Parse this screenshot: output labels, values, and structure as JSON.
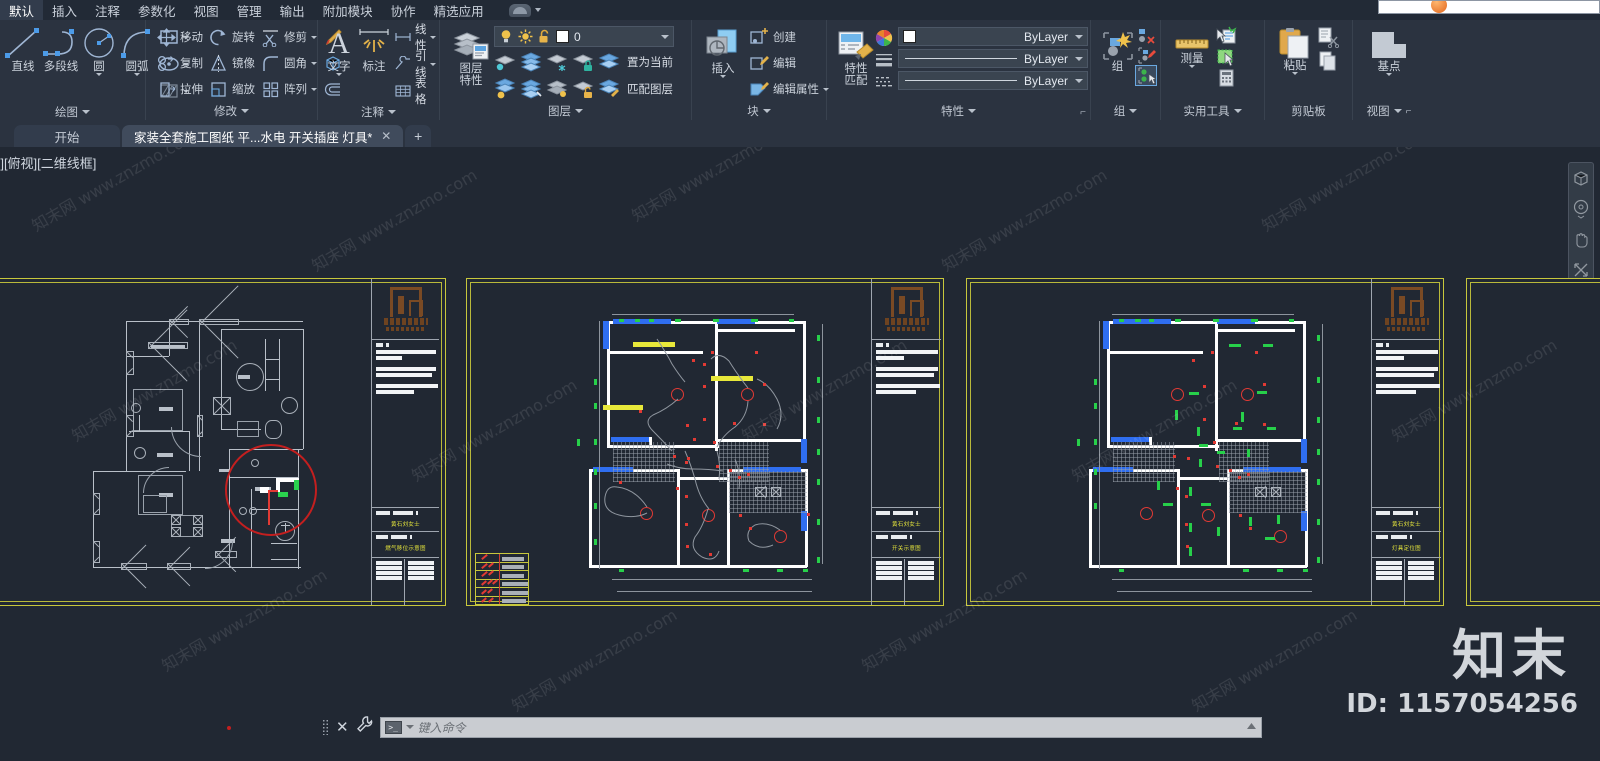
{
  "app": {
    "ribbon_tabs": [
      {
        "label": "默认",
        "active": true
      },
      {
        "label": "插入",
        "active": false
      },
      {
        "label": "注释",
        "active": false
      },
      {
        "label": "参数化",
        "active": false
      },
      {
        "label": "视图",
        "active": false
      },
      {
        "label": "管理",
        "active": false
      },
      {
        "label": "输出",
        "active": false
      },
      {
        "label": "附加模块",
        "active": false
      },
      {
        "label": "协作",
        "active": false
      },
      {
        "label": "精选应用",
        "active": false
      }
    ],
    "search_placeholder": ""
  },
  "ribbon": {
    "panels": [
      {
        "name": "draw",
        "title": "绘图",
        "big": [
          {
            "label": "直线",
            "icon": "line-icon"
          },
          {
            "label": "多段线",
            "icon": "polyline-icon"
          },
          {
            "label": "圆",
            "icon": "circle-icon",
            "dropdown": true
          },
          {
            "label": "圆弧",
            "icon": "arc-icon",
            "dropdown": true
          }
        ],
        "small": [
          {
            "label": "",
            "icon": "rectangle-icon",
            "dropdown": true
          },
          {
            "label": "",
            "icon": "ellipse-icon",
            "dropdown": true
          },
          {
            "label": "",
            "icon": "hatch-icon",
            "dropdown": true
          }
        ]
      },
      {
        "name": "modify",
        "title": "修改",
        "items": [
          {
            "label": "移动",
            "icon": "move-icon"
          },
          {
            "label": "旋转",
            "icon": "rotate-icon"
          },
          {
            "label": "修剪",
            "icon": "trim-icon",
            "dropdown": true
          },
          {
            "label": "",
            "icon": "brush-icon"
          },
          {
            "label": "复制",
            "icon": "copy-icon"
          },
          {
            "label": "镜像",
            "icon": "mirror-icon"
          },
          {
            "label": "圆角",
            "icon": "fillet-icon",
            "dropdown": true
          },
          {
            "label": "",
            "icon": "solid-icon"
          },
          {
            "label": "拉伸",
            "icon": "stretch-icon"
          },
          {
            "label": "缩放",
            "icon": "scale-icon"
          },
          {
            "label": "阵列",
            "icon": "array-icon",
            "dropdown": true
          },
          {
            "label": "",
            "icon": "offset-icon"
          }
        ]
      },
      {
        "name": "annotation",
        "title": "注释",
        "big": [
          {
            "label": "文字",
            "icon": "text-icon",
            "dropdown": true
          },
          {
            "label": "标注",
            "icon": "dimension-icon",
            "dropdown": true
          }
        ],
        "small": [
          {
            "label": "线性",
            "icon": "linear-dim-icon",
            "dropdown": true
          },
          {
            "label": "引线",
            "icon": "leader-icon",
            "dropdown": true
          },
          {
            "label": "表格",
            "icon": "table-icon"
          }
        ]
      },
      {
        "name": "layer",
        "title": "图层",
        "big": [
          {
            "label": "图层",
            "label2": "特性",
            "icon": "layer-properties-icon"
          }
        ],
        "current_layer": "0",
        "current_layer_color": "#ffffff",
        "row1": [
          {
            "icon": "layer-isolate-icon"
          },
          {
            "icon": "layer-off-icon"
          },
          {
            "icon": "layer-freeze-icon"
          },
          {
            "icon": "layer-lock-icon"
          },
          {
            "icon": "layer-make-current-icon",
            "label": "置为当前"
          }
        ],
        "row2": [
          {
            "icon": "layer-unisolate-icon"
          },
          {
            "icon": "layer-on-icon"
          },
          {
            "icon": "layer-thaw-icon"
          },
          {
            "icon": "layer-unlock-icon"
          },
          {
            "icon": "layer-match-icon",
            "label": "匹配图层"
          }
        ]
      },
      {
        "name": "block",
        "title": "块",
        "big": [
          {
            "label": "插入",
            "icon": "insert-block-icon",
            "dropdown": true
          }
        ],
        "small": [
          {
            "label": "创建",
            "icon": "create-block-icon"
          },
          {
            "label": "编辑",
            "icon": "edit-block-icon"
          },
          {
            "label": "编辑属性",
            "icon": "edit-attribute-icon",
            "dropdown": true
          }
        ]
      },
      {
        "name": "properties",
        "title": "特性",
        "big": [
          {
            "label": "特性",
            "label2": "匹配",
            "icon": "match-properties-icon"
          }
        ],
        "combos": [
          {
            "icon": "color-wheel-icon",
            "value": "ByLayer",
            "type": "color"
          },
          {
            "icon": "lineweight-icon",
            "value": "ByLayer",
            "type": "lineweight"
          },
          {
            "icon": "linetype-icon",
            "value": "ByLayer",
            "type": "linetype"
          }
        ]
      },
      {
        "name": "group",
        "title": "组",
        "big": [
          {
            "label": "组",
            "icon": "group-icon"
          }
        ],
        "small": [
          {
            "icon": "ungroup-icon"
          },
          {
            "icon": "group-edit-icon"
          },
          {
            "icon": "group-selection-icon",
            "selected": true
          }
        ]
      },
      {
        "name": "utilities",
        "title": "实用工具",
        "big": [
          {
            "label": "测量",
            "icon": "measure-icon",
            "dropdown": true
          }
        ],
        "small": [
          {
            "icon": "quick-select-icon"
          },
          {
            "icon": "select-similar-icon"
          },
          {
            "icon": "calculator-icon"
          }
        ]
      },
      {
        "name": "clipboard",
        "title": "剪贴板",
        "big": [
          {
            "label": "粘贴",
            "icon": "paste-icon",
            "dropdown": true
          }
        ],
        "small": [
          {
            "icon": "cut-icon"
          },
          {
            "icon": "copy-clip-icon"
          }
        ]
      },
      {
        "name": "view",
        "title": "视图",
        "big": [
          {
            "label": "基点",
            "icon": "base-point-icon",
            "dropdown": true
          }
        ]
      }
    ]
  },
  "file_tabs": [
    {
      "label": "开始",
      "active": false,
      "closable": false
    },
    {
      "label": "家装全套施工图纸 平...水电 开关插座 灯具*",
      "active": true,
      "closable": true,
      "close_label": "✕"
    }
  ],
  "file_tab_add_label": "+",
  "viewport": {
    "label": "-][俯视][二维线框]"
  },
  "navigation_bar": {
    "items": [
      {
        "icon": "viewcube-icon"
      },
      {
        "icon": "steering-wheel-icon",
        "dropdown": true
      },
      {
        "icon": "pan-icon"
      },
      {
        "icon": "zoom-extents-icon",
        "dropdown": true
      },
      {
        "icon": "orbit-icon",
        "dropdown": true
      },
      {
        "icon": "showmotion-icon"
      }
    ]
  },
  "drawings": [
    {
      "name": "gas-relocation-plan",
      "client": "黄石刘女士",
      "title": "燃气移位示意图",
      "logo_text_cn": "房知汇家装",
      "logo_text_en": "- HOUSE ONE -",
      "has_selection_highlight": true
    },
    {
      "name": "switch-layout-plan",
      "client": "黄石刘女士",
      "title": "开关示意图",
      "logo_text_cn": "房知汇家装",
      "logo_text_en": "- HOUSE ONE -",
      "legend_rows": 6
    },
    {
      "name": "lighting-position-plan",
      "client": "黄石刘女士",
      "title": "灯具定位图",
      "logo_text_cn": "房知汇家装",
      "logo_text_en": "- HOUSE ONE -"
    }
  ],
  "command_line": {
    "placeholder": "键入命令",
    "close_label": "✕",
    "icon_prompt": ">_"
  },
  "watermark": {
    "brand": "知末",
    "id": "ID: 1157054256",
    "tile_text": "知末网 www.znzmo.com"
  },
  "colors": {
    "ribbon_bg": "#2b3340",
    "canvas_bg": "#212833",
    "sheet_border": "#c8c83c",
    "accent_red": "#e23a34",
    "accent_green": "#27d04a",
    "accent_blue": "#2f6ef0",
    "accent_yellow": "#e8e83a",
    "title_text": "#e3e33c"
  }
}
